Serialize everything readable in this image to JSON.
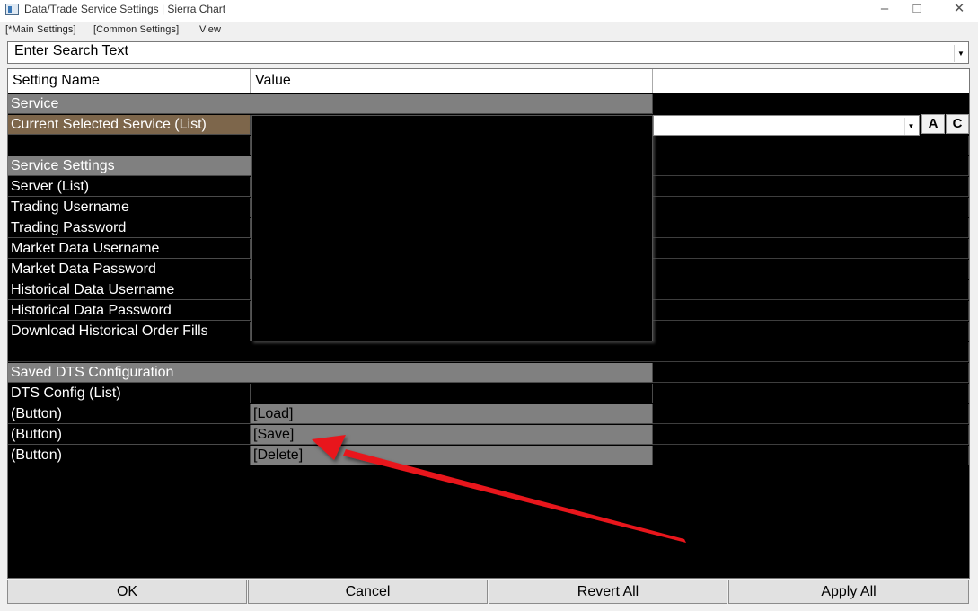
{
  "window": {
    "title": "Data/Trade Service Settings | Sierra Chart"
  },
  "menu": [
    "[*Main Settings]",
    "[Common Settings]",
    "View"
  ],
  "search": {
    "text": "Enter Search Text"
  },
  "table": {
    "columns": [
      "Setting Name",
      "Value"
    ],
    "section_service": "Service",
    "current_service": "Current Selected Service (List)",
    "section_service_settings": "Service Settings",
    "service_rows": [
      "Server (List)",
      "Trading Username",
      "Trading Password",
      "Market Data Username",
      "Market Data Password",
      "Historical Data Username",
      "Historical Data Password",
      "Download Historical Order Fills"
    ],
    "section_saved": "Saved DTS Configuration",
    "dts_config": "DTS Config (List)",
    "button_rows": [
      {
        "name": " (Button)",
        "value": "[Load]"
      },
      {
        "name": " (Button)",
        "value": "[Save]"
      },
      {
        "name": " (Button)",
        "value": "[Delete]"
      }
    ]
  },
  "combo_buttons": [
    "A",
    "C"
  ],
  "footer": {
    "ok": "OK",
    "cancel": "Cancel",
    "revert": "Revert All",
    "apply": "Apply All"
  },
  "colors": {
    "section_gray": "#808080",
    "selected_row": "#7d664b",
    "annotation_arrow": "#e8161b"
  }
}
